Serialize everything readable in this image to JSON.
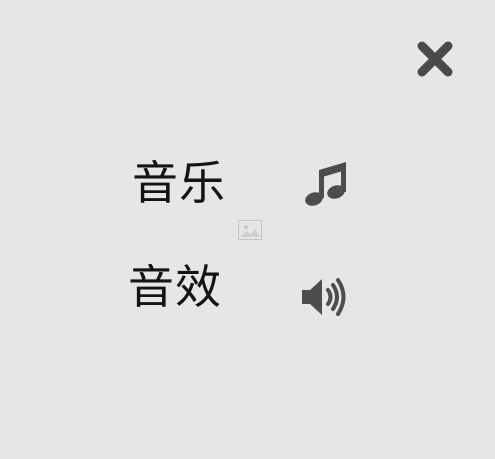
{
  "settings": {
    "music_label": "音乐",
    "sfx_label": "音效"
  },
  "icons": {
    "close": "close-icon",
    "music": "music-note-icon",
    "sfx": "speaker-volume-icon",
    "placeholder": "image-placeholder-icon"
  },
  "colors": {
    "background": "#e6e6e6",
    "icon": "#4d4d4d",
    "text": "#141414"
  }
}
